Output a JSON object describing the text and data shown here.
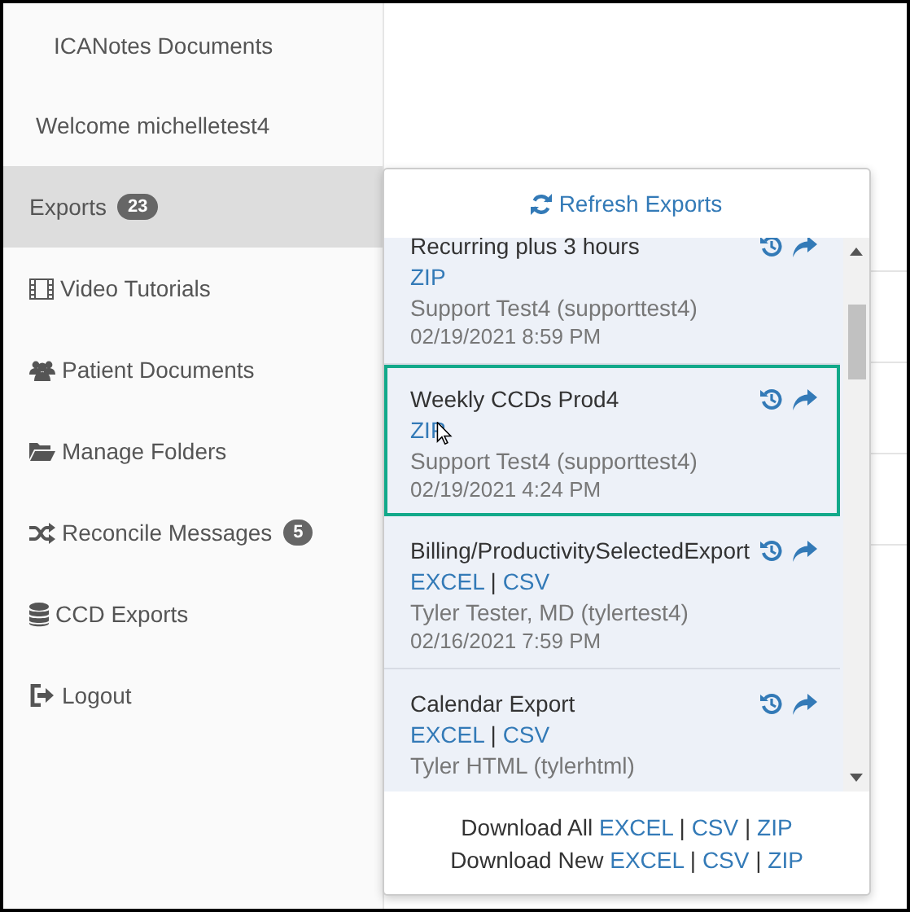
{
  "sidebar": {
    "title": "ICANotes Documents",
    "welcome": "Welcome michelletest4",
    "items": [
      {
        "label": "Exports",
        "badge": "23",
        "selected": true
      },
      {
        "label": "Video Tutorials",
        "selected": false
      },
      {
        "label": "Patient Documents",
        "selected": false
      },
      {
        "label": "Manage Folders",
        "selected": false
      },
      {
        "label": "Reconcile Messages",
        "badge": "5",
        "selected": false
      },
      {
        "label": "CCD Exports",
        "selected": false
      },
      {
        "label": "Logout",
        "selected": false
      }
    ]
  },
  "exports_popup": {
    "refresh": "Refresh Exports",
    "separator": "|",
    "rows": [
      {
        "title": "Recurring plus 3 hours",
        "links": [
          "ZIP"
        ],
        "author": "Support Test4 (supporttest4)",
        "date": "02/19/2021 8:59 PM",
        "selected": false
      },
      {
        "title": "Weekly CCDs Prod4",
        "links": [
          "ZIP"
        ],
        "author": "Support Test4 (supporttest4)",
        "date": "02/19/2021 4:24 PM",
        "selected": true
      },
      {
        "title": "Billing/ProductivitySelectedExport",
        "links": [
          "EXCEL",
          "CSV"
        ],
        "author": "Tyler Tester, MD (tylertest4)",
        "date": "02/16/2021 7:59 PM",
        "selected": false
      },
      {
        "title": "Calendar Export",
        "links": [
          "EXCEL",
          "CSV"
        ],
        "author": "Tyler HTML (tylerhtml)",
        "selected": false
      }
    ],
    "downloads": [
      {
        "label": "Download All",
        "links": [
          "EXCEL",
          "CSV",
          "ZIP"
        ]
      },
      {
        "label": "Download New",
        "links": [
          "EXCEL",
          "CSV",
          "ZIP"
        ]
      }
    ]
  }
}
